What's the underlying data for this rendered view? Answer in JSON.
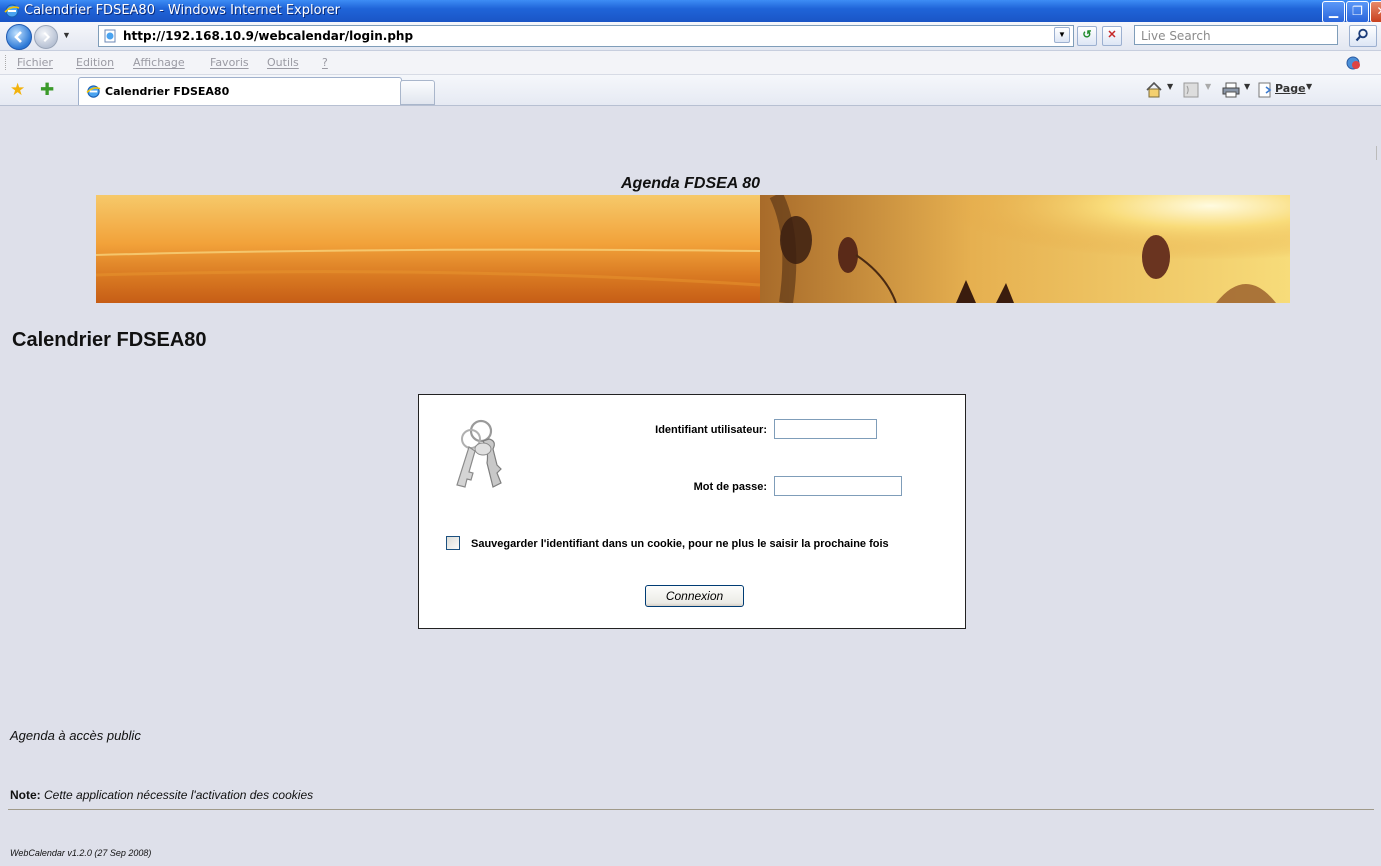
{
  "window": {
    "title": "Calendrier FDSEA80 - Windows Internet Explorer",
    "minimize": "▁",
    "maximize": "❐",
    "close": "✕"
  },
  "addressbar": {
    "url": "http://192.168.10.9/webcalendar/login.php",
    "search_placeholder": "Live Search"
  },
  "menu": {
    "items": [
      "Fichier",
      "Edition",
      "Affichage",
      "Favoris",
      "Outils",
      "?"
    ]
  },
  "tabs": {
    "active_label": "Calendrier FDSEA80"
  },
  "commandbar": {
    "page_label": "Page"
  },
  "page": {
    "heading": "Agenda FDSEA 80",
    "title": "Calendrier FDSEA80",
    "login": {
      "username_label": "Identifiant utilisateur:",
      "username_value": "",
      "password_label": "Mot de passe:",
      "password_value": "",
      "remember_label": "Sauvegarder l'identifiant dans un cookie, pour ne plus le saisir la prochaine fois",
      "remember_checked": false,
      "submit_label": "Connexion"
    },
    "public_link": "Agenda à accès public",
    "note_label": "Note:",
    "note_text": " Cette application nécessite l'activation des cookies",
    "version": "WebCalendar v1.2.0 (27 Sep 2008)"
  },
  "colors": {
    "page_bg": "#dee0ea",
    "titlebar": "#1f64d8",
    "login_box_bg": "#ffffff"
  }
}
